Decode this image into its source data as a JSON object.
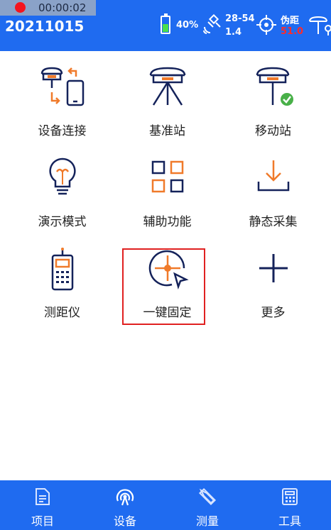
{
  "recording": {
    "time": "00:00:02"
  },
  "header": {
    "date": "20211015",
    "battery_text": "40%",
    "battery_level": 0.4,
    "satellites": "28-54",
    "precision": "1.4",
    "pseudo_range_label": "伪距",
    "pseudo_range_value": "51.0"
  },
  "grid": {
    "items": [
      {
        "label": "设备连接",
        "icon": "device-connect-icon"
      },
      {
        "label": "基准站",
        "icon": "base-station-icon"
      },
      {
        "label": "移动站",
        "icon": "rover-station-icon"
      },
      {
        "label": "演示模式",
        "icon": "bulb-icon"
      },
      {
        "label": "辅助功能",
        "icon": "grid-apps-icon"
      },
      {
        "label": "静态采集",
        "icon": "download-icon"
      },
      {
        "label": "测距仪",
        "icon": "rangefinder-icon"
      },
      {
        "label": "一键固定",
        "icon": "crosshair-icon"
      },
      {
        "label": "更多",
        "icon": "plus-icon"
      }
    ]
  },
  "nav": {
    "items": [
      {
        "label": "项目",
        "icon": "document-icon"
      },
      {
        "label": "设备",
        "icon": "antenna-icon"
      },
      {
        "label": "测量",
        "icon": "pen-ruler-icon"
      },
      {
        "label": "工具",
        "icon": "calculator-icon"
      }
    ]
  },
  "colors": {
    "primary": "#1f6bf0",
    "icon_navy": "#14225a",
    "icon_orange": "#f07a2a",
    "highlight": "#e02020"
  }
}
